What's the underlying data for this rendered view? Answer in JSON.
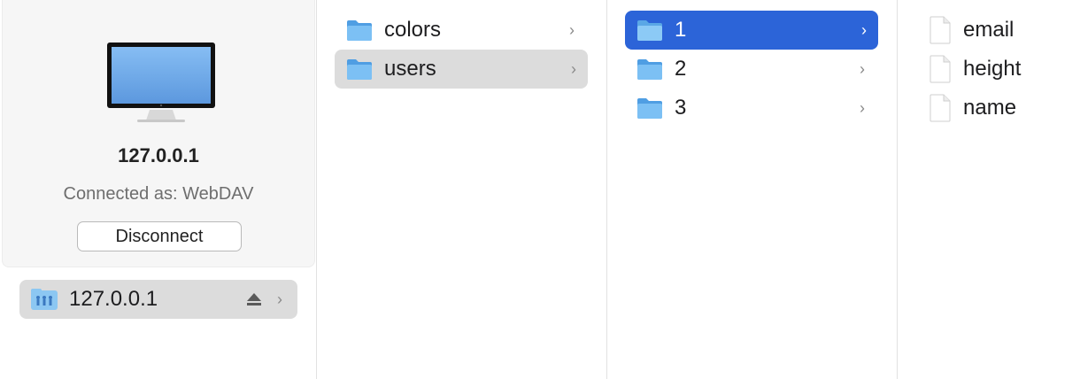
{
  "server": {
    "name": "127.0.0.1",
    "status": "Connected as: WebDAV",
    "disconnect_label": "Disconnect",
    "sidebar_label": "127.0.0.1"
  },
  "column2": {
    "items": [
      {
        "label": "colors"
      },
      {
        "label": "users"
      }
    ]
  },
  "column3": {
    "items": [
      {
        "label": "1"
      },
      {
        "label": "2"
      },
      {
        "label": "3"
      }
    ]
  },
  "column4": {
    "items": [
      {
        "label": "email"
      },
      {
        "label": "height"
      },
      {
        "label": "name"
      }
    ]
  },
  "glyphs": {
    "chevron": "›"
  },
  "colors": {
    "selection": "#2c64d8",
    "inactive_selection": "#dcdcdc",
    "folder": "#6ab4ee"
  }
}
